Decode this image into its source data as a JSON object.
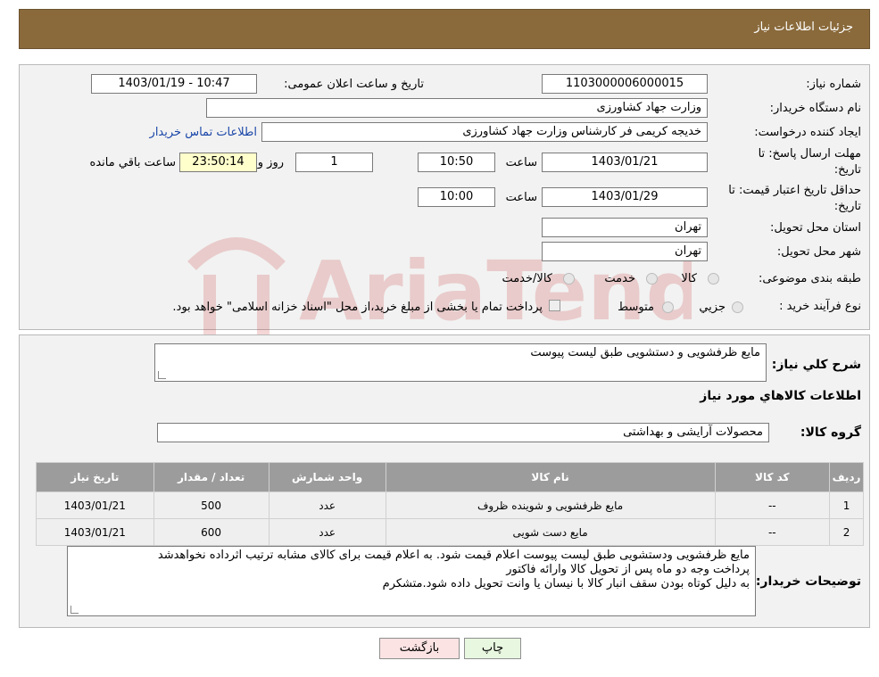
{
  "header": {
    "title": "جزئیات اطلاعات نیاز"
  },
  "form": {
    "need_number_label": "شماره نیاز:",
    "need_number": "1103000006000015",
    "announce_label": "تاریخ و ساعت اعلان عمومی:",
    "announce_value": "1403/01/19 - 10:47",
    "buyer_org_label": "نام دستگاه خریدار:",
    "buyer_org": "وزارت جهاد کشاورزی",
    "creator_label": "ایجاد کننده درخواست:",
    "creator": "خدیجه کریمی فر کارشناس وزارت جهاد کشاورزی",
    "contact_link": "اطلاعات تماس خریدار",
    "deadline_label_1": "مهلت ارسال پاسخ: تا",
    "deadline_label_2": "تاریخ:",
    "deadline_date": "1403/01/21",
    "time_label": "ساعت",
    "deadline_time": "10:50",
    "days_value": "1",
    "days_label": "روز و",
    "remaining_time": "23:50:14",
    "remaining_label": "ساعت باقي مانده",
    "validity_label_1": "حداقل تاریخ اعتبار قیمت: تا",
    "validity_label_2": "تاریخ:",
    "validity_date": "1403/01/29",
    "validity_time": "10:00",
    "province_label": "استان محل تحویل:",
    "province": "تهران",
    "city_label": "شهر محل تحویل:",
    "city": "تهران",
    "category_label": "طبقه بندی موضوعی:",
    "category_options": [
      "کالا",
      "خدمت",
      "کالا/خدمت"
    ],
    "process_label": "نوع فرآیند خرید :",
    "process_options": [
      "جزيي",
      "متوسط"
    ],
    "payment_note": "پرداخت تمام یا بخشی از مبلغ خرید،از محل \"اسناد خزانه اسلامی\" خواهد بود."
  },
  "details": {
    "summary_label": "شرح کلي نياز:",
    "summary": "مایع ظرفشویی و دستشویی طبق لیست پیوست",
    "goods_info_title": "اطلاعات کالاهاي مورد نياز",
    "group_label": "گروه کالا:",
    "group": "محصولات آرایشی و بهداشتی",
    "table_headers": [
      "رديف",
      "کد کالا",
      "نام کالا",
      "واحد شمارش",
      "تعداد / مقدار",
      "تاریخ نیاز"
    ],
    "rows": [
      [
        "1",
        "--",
        "مایع ظرفشویی و شوینده ظروف",
        "عدد",
        "500",
        "1403/01/21"
      ],
      [
        "2",
        "--",
        "مایع دست شویی",
        "عدد",
        "600",
        "1403/01/21"
      ]
    ],
    "buyer_notes_label": "توضیحات خریدار:",
    "buyer_notes": [
      "مایع ظرفشویی ودستشویی طبق لیست پیوست اعلام قیمت شود. به اعلام قیمت برای کالای مشابه ترتیب اثرداده نخواهدشد",
      "پرداخت وجه دو ماه پس از تحویل کالا وارائه فاکتور",
      "به دلیل کوتاه بودن سقف انبار کالا با نیسان یا وانت تحویل داده شود.متشکرم"
    ]
  },
  "buttons": {
    "print": "چاپ",
    "back": "بازگشت"
  },
  "watermark_text": "AriaTender.neT"
}
